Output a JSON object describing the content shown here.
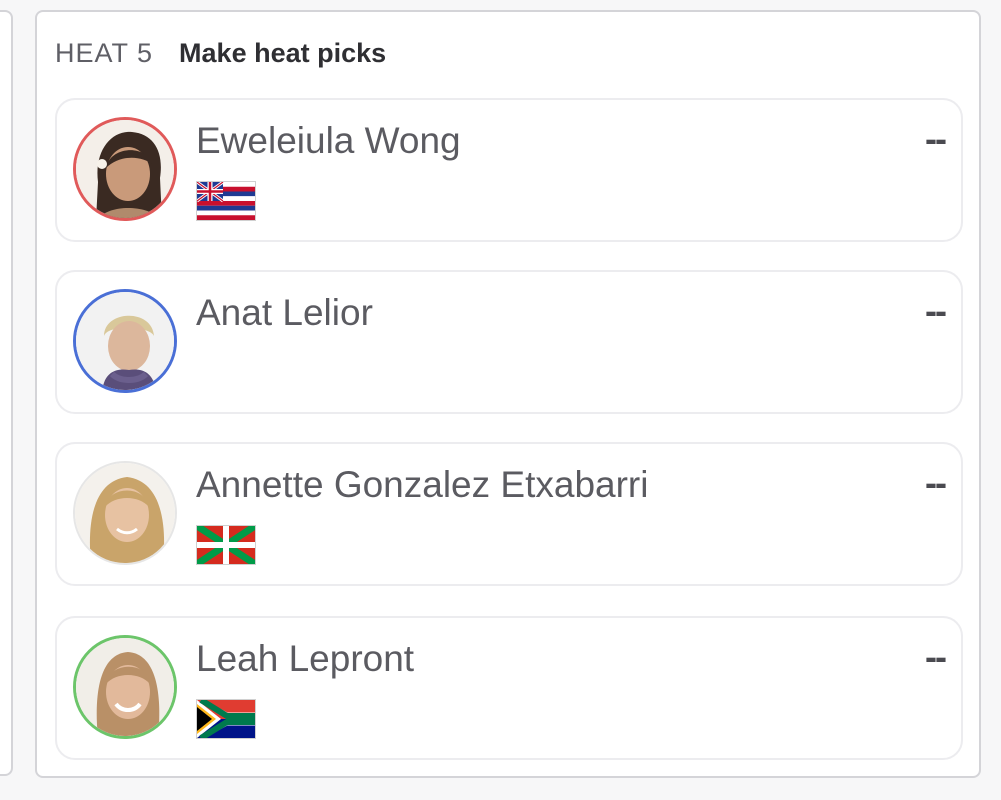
{
  "heat": {
    "label": "HEAT 5",
    "action": "Make heat picks"
  },
  "athletes": [
    {
      "name": "Eweleiula Wong",
      "pick": "--",
      "ring_color": "#e05a5a",
      "flag": "hawaii-flag-icon"
    },
    {
      "name": "Anat Lelior",
      "pick": "--",
      "ring_color": "#4a6fd6",
      "flag": ""
    },
    {
      "name": "Annette Gonzalez Etxabarri",
      "pick": "--",
      "ring_color": "#e6e6e6",
      "flag": "basque-flag-icon"
    },
    {
      "name": "Leah Lepront",
      "pick": "--",
      "ring_color": "#6cc56a",
      "flag": "south-africa-flag-icon"
    }
  ]
}
